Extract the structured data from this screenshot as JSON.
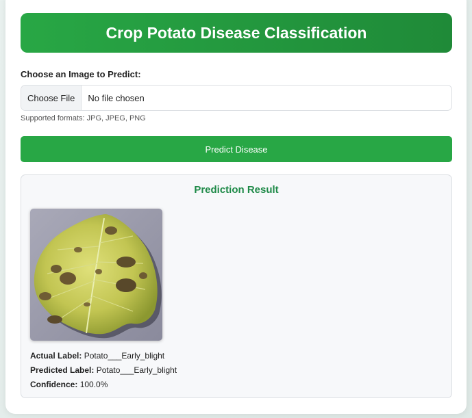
{
  "header": {
    "title": "Crop Potato Disease Classification"
  },
  "upload": {
    "label": "Choose an Image to Predict:",
    "button_label": "Choose File",
    "status": "No file chosen",
    "supported_formats": "Supported formats: JPG, JPEG, PNG"
  },
  "predict_button": {
    "label": "Predict Disease"
  },
  "result": {
    "title": "Prediction Result",
    "actual_label_key": "Actual Label:",
    "actual_label_value": "Potato___Early_blight",
    "predicted_label_key": "Predicted Label:",
    "predicted_label_value": "Potato___Early_blight",
    "confidence_key": "Confidence:",
    "confidence_value": "100.0%"
  },
  "colors": {
    "primary_green": "#28a745",
    "dark_green": "#1f8a38",
    "result_title_green": "#1f8a48"
  }
}
